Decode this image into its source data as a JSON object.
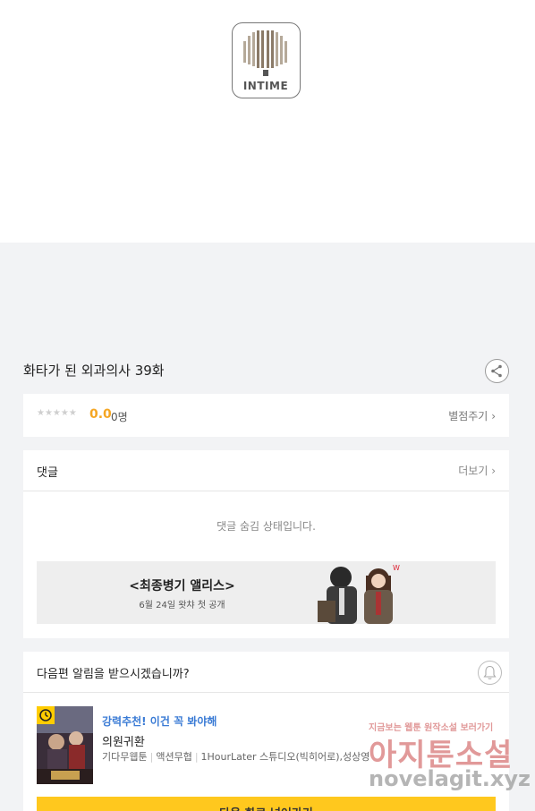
{
  "logo": {
    "text": "INTIME"
  },
  "episode": {
    "title": "화타가 된 외과의사 39화"
  },
  "rating": {
    "stars": "★★★★★",
    "score": "0.0",
    "count": "0명",
    "rate_label": "별점주기"
  },
  "comments": {
    "title": "댓글",
    "more_label": "더보기",
    "hidden_message": "댓글 숨김 상태입니다."
  },
  "banner": {
    "title": "<최종병기 앨리스>",
    "subtitle": "6월 24일 왓챠 첫 공개",
    "art_logo": "W"
  },
  "next": {
    "question": "다음편 알림을 받으시겠습니까?",
    "recommend_label": "강력추천! 이건 꼭 봐야해",
    "comic_name": "의원귀환",
    "meta": [
      "기다무웹툰",
      "액션무협",
      "1HourLater 스튜디오(빅히어로),성상영"
    ],
    "cta_label": "다음 화로 넘어가기"
  },
  "watermark": {
    "small": "지금보는 웹툰 원작소설 보러가기",
    "big": "아지툰소설",
    "url": "novelagit.xyz"
  },
  "colors": {
    "accent_yellow": "#ffc81e",
    "score_orange": "#f5a623",
    "link_blue": "#3a7bd5"
  },
  "icons": [
    "share-icon",
    "chevron-right-icon",
    "bell-icon",
    "clock-icon"
  ]
}
